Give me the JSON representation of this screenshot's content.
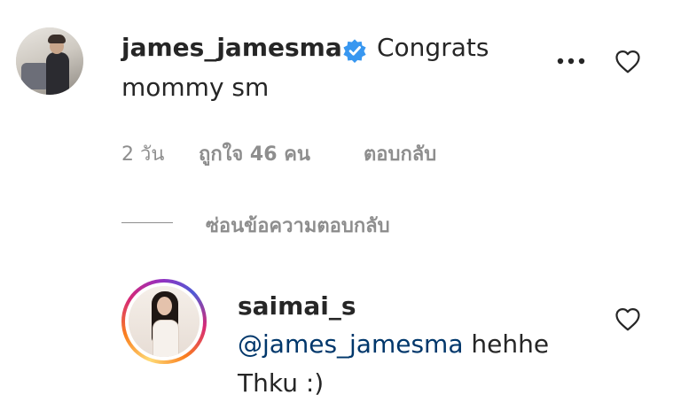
{
  "comment": {
    "username": "james_jamesma",
    "text_line1": "Congrats",
    "text_line2": "mommy sm",
    "time": "2 วัน",
    "likes": "ถูกใจ 46 คน",
    "reply_label": "ตอบกลับ",
    "hide_replies_label": "ซ่อนข้อความตอบกลับ"
  },
  "reply": {
    "username": "saimai_s",
    "mention": "@james_jamesma",
    "text_after_mention": " hehhe",
    "text_line2": "Thku :)"
  },
  "colors": {
    "text": "#262626",
    "secondary": "#8e8e8e",
    "mention": "#00376b",
    "verified": "#3897f0"
  },
  "icons": {
    "verified": "verified-badge-icon",
    "more": "more-options-icon",
    "heart": "heart-outline-icon"
  }
}
